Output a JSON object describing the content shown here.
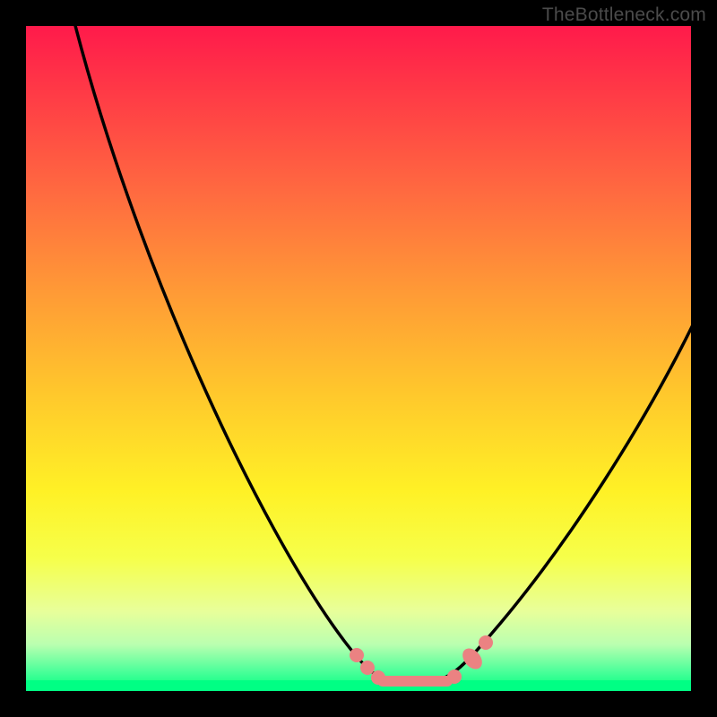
{
  "attribution": "TheBottleneck.com",
  "colors": {
    "background": "#000000",
    "curve": "#000000",
    "marker": "#eb8282",
    "gradient_top": "#ff1a4b",
    "gradient_bottom": "#00ff80"
  },
  "chart_data": {
    "type": "line",
    "title": "",
    "xlabel": "",
    "ylabel": "",
    "xlim": [
      0,
      100
    ],
    "ylim": [
      0,
      100
    ],
    "x": [
      0,
      5,
      10,
      15,
      20,
      25,
      30,
      35,
      40,
      45,
      50,
      52,
      55,
      58,
      60,
      63,
      65,
      70,
      75,
      80,
      85,
      90,
      95,
      100
    ],
    "y": [
      105,
      95,
      85,
      74,
      63,
      52,
      42,
      32,
      23,
      15,
      8,
      5,
      2,
      0,
      0,
      0,
      1,
      5,
      12,
      21,
      31,
      42,
      53,
      63
    ],
    "series_name": "bottleneck-curve",
    "markers": [
      {
        "x": 50,
        "y": 8
      },
      {
        "x": 52,
        "y": 5
      },
      {
        "x": 54,
        "y": 2
      },
      {
        "x": 67,
        "y": 2
      },
      {
        "x": 69,
        "y": 5
      },
      {
        "x": 71,
        "y": 9
      }
    ],
    "flat_segment": {
      "x0": 55,
      "x1": 65,
      "y": 0
    },
    "annotations": []
  }
}
